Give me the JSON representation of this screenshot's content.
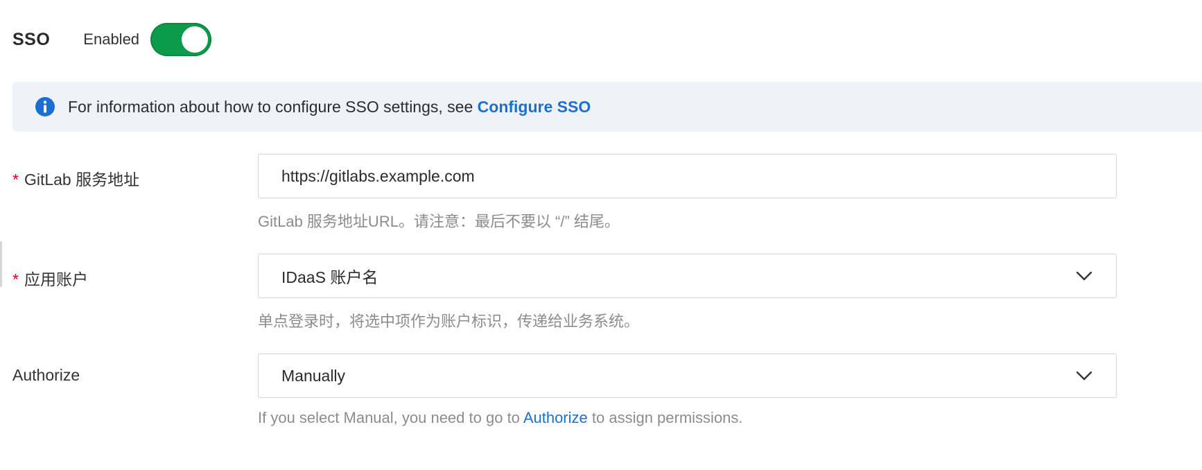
{
  "header": {
    "title": "SSO",
    "toggle_label": "Enabled",
    "toggle_on": true
  },
  "info_banner": {
    "text": "For information about how to configure SSO settings, see ",
    "link_text": "Configure SSO"
  },
  "fields": {
    "gitlab_url": {
      "required_mark": "*",
      "label": "GitLab 服务地址",
      "value": "https://gitlabs.example.com",
      "help": "GitLab 服务地址URL。请注意：最后不要以 “/” 结尾。"
    },
    "app_account": {
      "required_mark": "*",
      "label": "应用账户",
      "value": "IDaaS 账户名",
      "help": "单点登录时，将选中项作为账户标识，传递给业务系统。"
    },
    "authorize": {
      "label": "Authorize",
      "value": "Manually",
      "help_prefix": "If you select Manual, you need to go to ",
      "help_link": "Authorize",
      "help_suffix": " to assign permissions."
    }
  },
  "colors": {
    "toggle_on": "#0c9a4b",
    "link": "#1a6fd1",
    "required": "#d0021b",
    "banner_bg": "#eff3f8",
    "info_icon": "#1a6fd1"
  },
  "icons": {
    "info": "info-circle-icon",
    "dropdown": "chevron-down-icon"
  }
}
